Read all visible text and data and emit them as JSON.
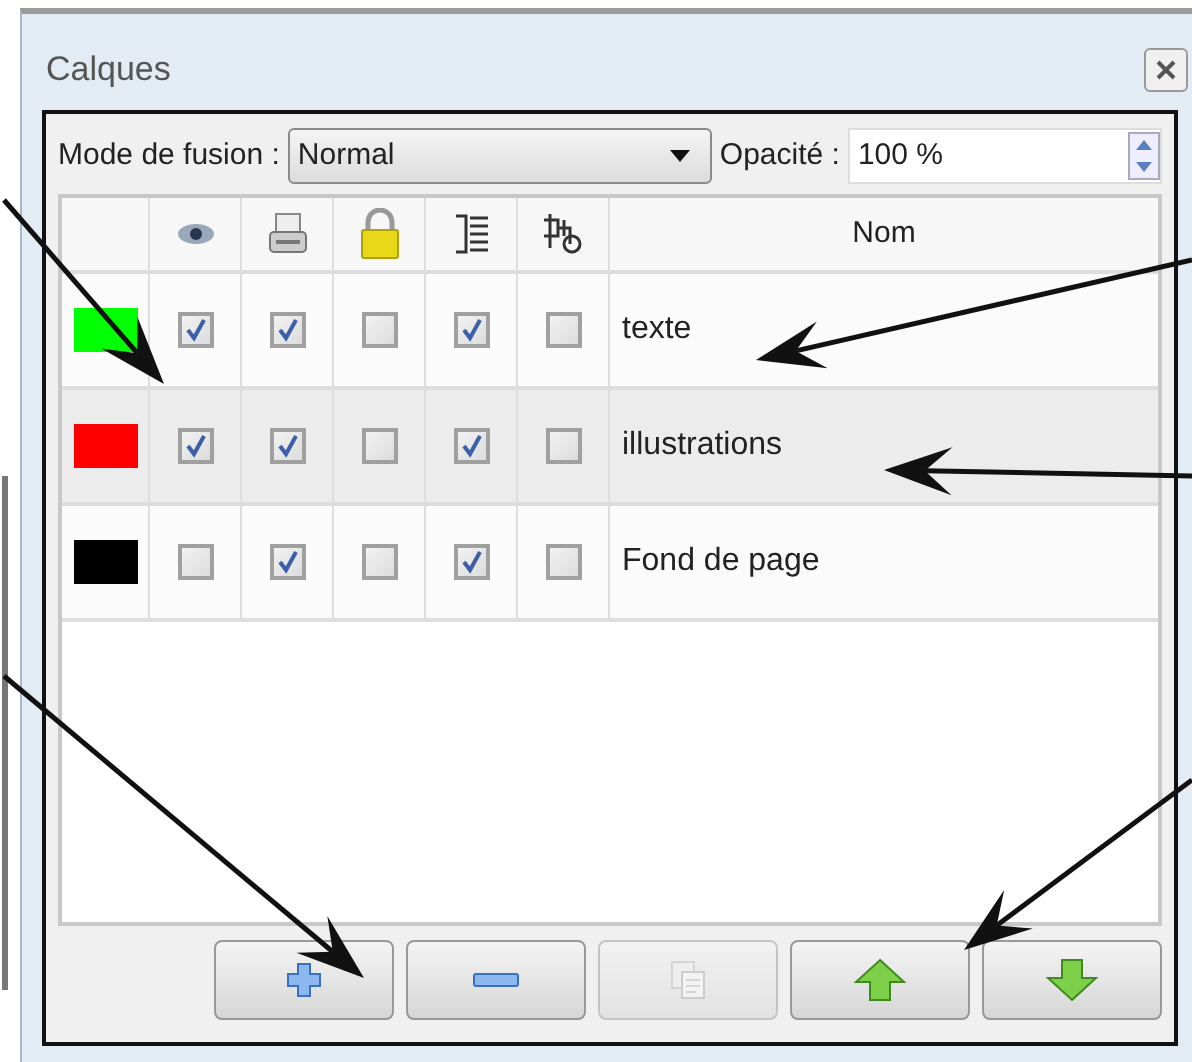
{
  "panel": {
    "title": "Calques"
  },
  "blend_mode": {
    "label": "Mode de fusion :",
    "value": "Normal"
  },
  "opacity": {
    "label": "Opacité :",
    "value": "100 %"
  },
  "table": {
    "name_column": "Nom",
    "layers": [
      {
        "color": "#00ff00",
        "name": "texte",
        "checks": [
          {
            "checked": true
          },
          {
            "checked": true
          },
          {
            "checked": false
          },
          {
            "checked": true
          },
          {
            "checked": false
          }
        ],
        "selected": false
      },
      {
        "color": "#ff0000",
        "name": "illustrations",
        "checks": [
          {
            "checked": true
          },
          {
            "checked": true
          },
          {
            "checked": false
          },
          {
            "checked": true
          },
          {
            "checked": false
          }
        ],
        "selected": true
      },
      {
        "color": "#000000",
        "name": "Fond de page",
        "checks": [
          {
            "checked": false
          },
          {
            "checked": true
          },
          {
            "checked": false
          },
          {
            "checked": true
          },
          {
            "checked": false
          }
        ],
        "selected": false
      }
    ]
  },
  "buttons": [
    {
      "kind": "add",
      "disabled": false
    },
    {
      "kind": "remove",
      "disabled": false
    },
    {
      "kind": "duplicate",
      "disabled": true
    },
    {
      "kind": "up",
      "disabled": false
    },
    {
      "kind": "down",
      "disabled": false
    }
  ]
}
